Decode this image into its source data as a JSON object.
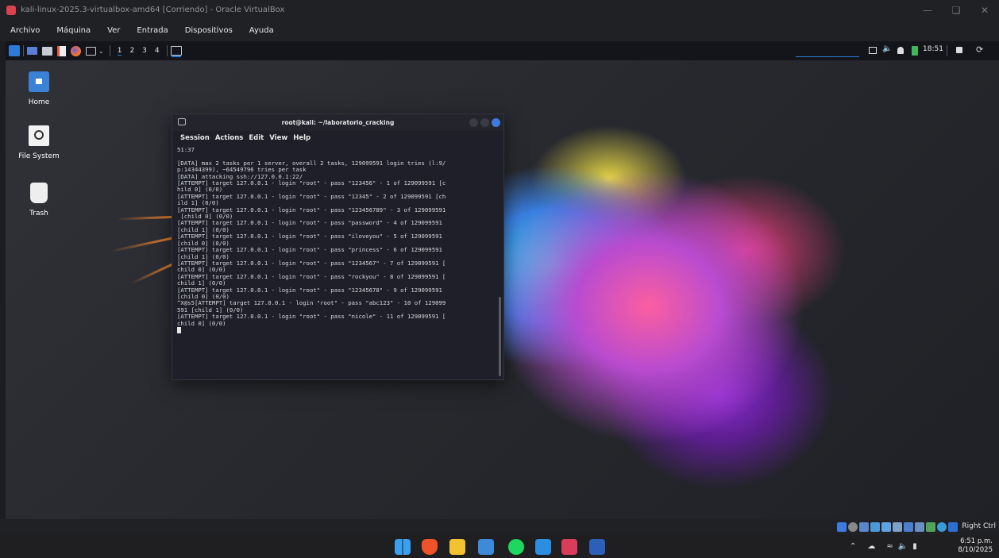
{
  "vbox": {
    "title": "kali-linux-2025.3-virtualbox-amd64 [Corriendo] - Oracle VirtualBox",
    "menu": [
      "Archivo",
      "Máquina",
      "Ver",
      "Entrada",
      "Dispositivos",
      "Ayuda"
    ],
    "host_key": "Right Ctrl"
  },
  "kali_panel": {
    "workspaces": [
      "1",
      "2",
      "3",
      "4"
    ],
    "time": "18:51"
  },
  "desktop_icons": [
    {
      "label": "Home",
      "icon": "home-folder-icon"
    },
    {
      "label": "File System",
      "icon": "drive-icon"
    },
    {
      "label": "Trash",
      "icon": "trash-icon"
    }
  ],
  "terminal": {
    "title": "root@kali: ~/laboratorio_cracking",
    "menu": [
      "Session",
      "Actions",
      "Edit",
      "View",
      "Help"
    ],
    "output": "51:37\n\n[DATA] max 2 tasks per 1 server, overall 2 tasks, 129099591 login tries (l:9/\np:14344399), ~64549796 tries per task\n[DATA] attacking ssh://127.0.0.1:22/\n[ATTEMPT] target 127.0.0.1 - login \"root\" - pass \"123456\" - 1 of 129099591 [c\nhild 0] (0/0)\n[ATTEMPT] target 127.0.0.1 - login \"root\" - pass \"12345\" - 2 of 129099591 [ch\nild 1] (0/0)\n[ATTEMPT] target 127.0.0.1 - login \"root\" - pass \"123456789\" - 3 of 129099591\n [child 0] (0/0)\n[ATTEMPT] target 127.0.0.1 - login \"root\" - pass \"password\" - 4 of 129099591\n[child 1] (0/0)\n[ATTEMPT] target 127.0.0.1 - login \"root\" - pass \"iloveyou\" - 5 of 129099591\n[child 0] (0/0)\n[ATTEMPT] target 127.0.0.1 - login \"root\" - pass \"princess\" - 6 of 129099591\n[child 1] (0/0)\n[ATTEMPT] target 127.0.0.1 - login \"root\" - pass \"1234567\" - 7 of 129099591 [\nchild 0] (0/0)\n[ATTEMPT] target 127.0.0.1 - login \"root\" - pass \"rockyou\" - 8 of 129099591 [\nchild 1] (0/0)\n[ATTEMPT] target 127.0.0.1 - login \"root\" - pass \"12345678\" - 9 of 129099591\n[child 0] (0/0)\n^X@s5[ATTEMPT] target 127.0.0.1 - login \"root\" - pass \"abc123\" - 10 of 129099\n591 [child 1] (0/0)\n[ATTEMPT] target 127.0.0.1 - login \"root\" - pass \"nicole\" - 11 of 129099591 [\nchild 0] (0/0)\n"
  },
  "taskbar": {
    "time": "6:51 p.m.",
    "date": "8/10/2025"
  },
  "colors": {
    "kali_blue": "#2e7bd6",
    "terminal_bg": "#1e1f29",
    "accent_orange": "#ff8a2a"
  }
}
